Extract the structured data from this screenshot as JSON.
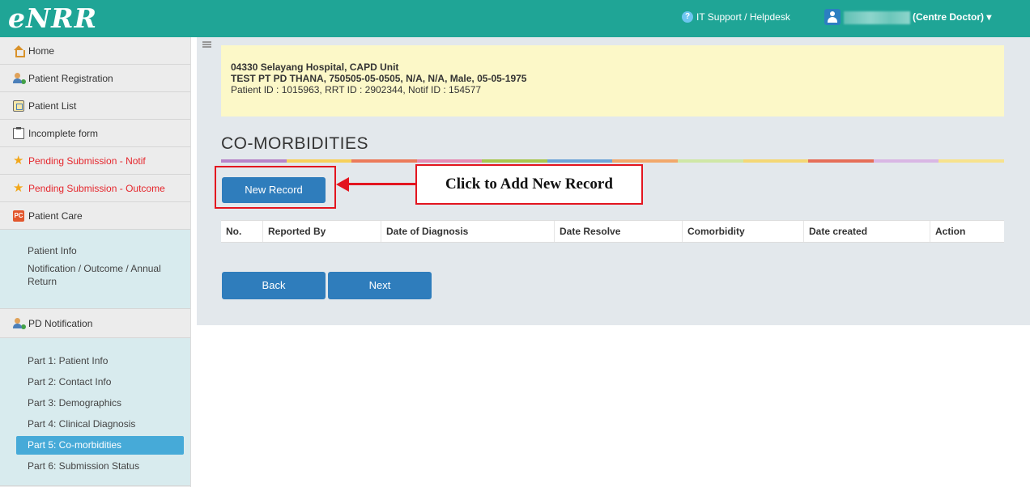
{
  "header": {
    "logo": "eNRR",
    "help_label": "IT Support / Helpdesk",
    "help_icon": "question-icon",
    "user_icon": "user-icon",
    "user_role": "(Centre Doctor)",
    "dropdown_caret": "▾",
    "bar_color": "#1fa596"
  },
  "sidebar": {
    "items": [
      {
        "label": "Home",
        "icon": "home-icon"
      },
      {
        "label": "Patient Registration",
        "icon": "user-add-icon"
      },
      {
        "label": "Patient List",
        "icon": "list-icon"
      },
      {
        "label": "Incomplete form",
        "icon": "clipboard-icon"
      },
      {
        "label": "Pending Submission - Notif",
        "icon": "star-icon",
        "color": "#e5272d"
      },
      {
        "label": "Pending Submission - Outcome",
        "icon": "star-icon",
        "color": "#e5272d"
      },
      {
        "label": "Patient Care",
        "icon": "pc-icon"
      }
    ],
    "care_sub": [
      "Patient Info",
      "Notification / Outcome / Annual Return"
    ],
    "pd_notification": {
      "label": "PD Notification",
      "icon": "user-add-icon"
    },
    "pd_sub": [
      "Part 1: Patient Info",
      "Part 2: Contact Info",
      "Part 3: Demographics",
      "Part 4: Clinical Diagnosis",
      "Part 5: Co-morbidities",
      "Part 6: Submission Status"
    ],
    "active_sub": "Part 5: Co-morbidities",
    "active_color": "#46aad8"
  },
  "patient": {
    "centre": "04330 Selayang Hospital, CAPD Unit",
    "details": "TEST PT PD THANA, 750505-05-0505, N/A, N/A, Male, 05-05-1975",
    "ids": "Patient ID : 1015963, RRT ID : 2902344, Notif ID : 154577"
  },
  "main": {
    "title": "CO-MORBIDITIES",
    "new_record_label": "New Record",
    "back_label": "Back",
    "next_label": "Next",
    "button_color": "#2f7dbc"
  },
  "table": {
    "columns": [
      "No.",
      "Reported By",
      "Date of Diagnosis",
      "Date Resolve",
      "Comorbidity",
      "Date created",
      "Action"
    ]
  },
  "annotation": {
    "callout_text": "Click to Add New Record",
    "color": "#e3151f"
  },
  "rainbow_colors": [
    "#b784c9",
    "#f7d05a",
    "#ec7a5a",
    "#e68bb3",
    "#a9c64e",
    "#6fa5d8",
    "#f2a86b",
    "#cfe7a6",
    "#f4d775",
    "#e66e58",
    "#d9b6e4",
    "#f7e28d"
  ]
}
